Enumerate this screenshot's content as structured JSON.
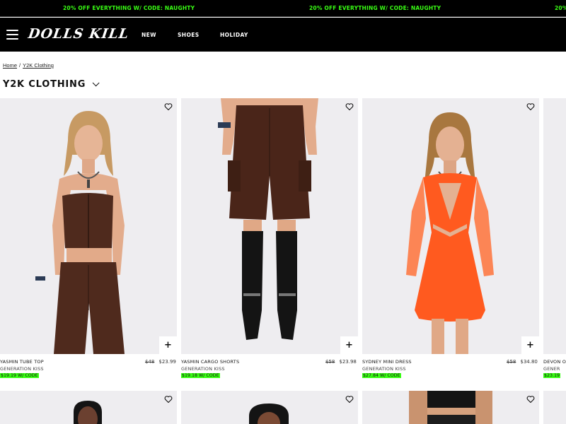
{
  "promo_bar": {
    "message": "20% OFF EVERYTHING W/ CODE: NAUGHTY"
  },
  "header": {
    "logo": "DOLLS KILL",
    "nav": [
      "NEW",
      "SHOES",
      "HOLIDAY"
    ]
  },
  "breadcrumb": {
    "home": "Home",
    "separator": "/",
    "current": "Y2K Clothing"
  },
  "page_title": "Y2K CLOTHING",
  "colors": {
    "accent_green": "#39ff14",
    "header_bg": "#000000",
    "image_bg": "#eeedf0"
  },
  "products": [
    {
      "name": "YASMIN TUBE TOP",
      "brand": "GENERATION KISS",
      "original_price": "$48",
      "sale_price": "$23.99",
      "code_price": "$19.19 W/ CODE"
    },
    {
      "name": "YASMIN CARGO SHORTS",
      "brand": "GENERATION KISS",
      "original_price": "$58",
      "sale_price": "$23.98",
      "code_price": "$19.18 W/ CODE"
    },
    {
      "name": "SYDNEY MINI DRESS",
      "brand": "GENERATION KISS",
      "original_price": "$58",
      "sale_price": "$34.80",
      "code_price": "$27.84 W/ CODE"
    },
    {
      "name": "DEVON O-",
      "brand": "GENER",
      "code_price": "$23.19"
    }
  ],
  "icons": {
    "menu": "hamburger-icon",
    "heart": "heart-icon",
    "plus": "plus-icon",
    "chevron": "chevron-down-icon"
  }
}
